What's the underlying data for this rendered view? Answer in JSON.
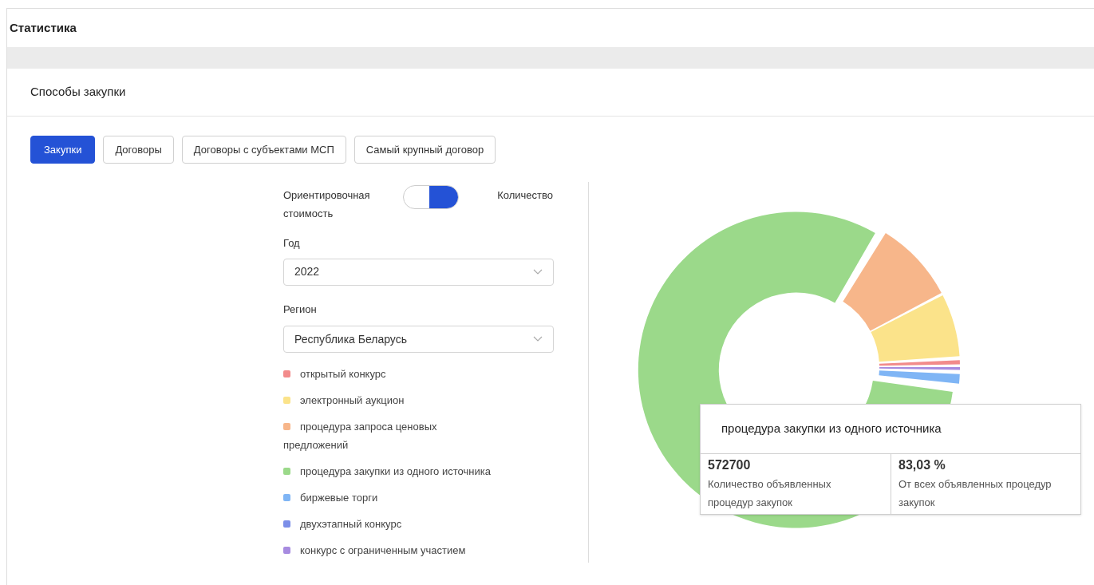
{
  "page_title": "Статистика",
  "card_title": "Способы закупки",
  "tabs": [
    {
      "label": "Закупки",
      "selected": true
    },
    {
      "label": "Договоры",
      "selected": false
    },
    {
      "label": "Договоры с субъектами МСП",
      "selected": false
    },
    {
      "label": "Самый крупный договор",
      "selected": false
    }
  ],
  "toggle": {
    "left_label": "Ориентировочная стоимость",
    "right_label": "Количество",
    "on": true
  },
  "year": {
    "label": "Год",
    "value": "2022"
  },
  "region": {
    "label": "Регион",
    "value": "Республика Беларусь"
  },
  "legend": [
    {
      "label": "открытый конкурс",
      "color": "#f28b8b"
    },
    {
      "label": "электронный аукцион",
      "color": "#fbe38a"
    },
    {
      "label": "процедура запроса ценовых предложений",
      "color": "#f7b68a"
    },
    {
      "label": "процедура закупки из одного источника",
      "color": "#9bd98a"
    },
    {
      "label": "биржевые торги",
      "color": "#7fb5f5"
    },
    {
      "label": "двухэтапный конкурс",
      "color": "#7b8ee8"
    },
    {
      "label": "конкурс с ограниченным участием",
      "color": "#a78be0"
    }
  ],
  "tooltip": {
    "title": "процедура закупки из одного источника",
    "cells": [
      {
        "value": "572700",
        "caption": "Количество объявленных процедур закупок"
      },
      {
        "value": "83,03 %",
        "caption": "От всех объявленных процедур закупок"
      }
    ]
  }
}
